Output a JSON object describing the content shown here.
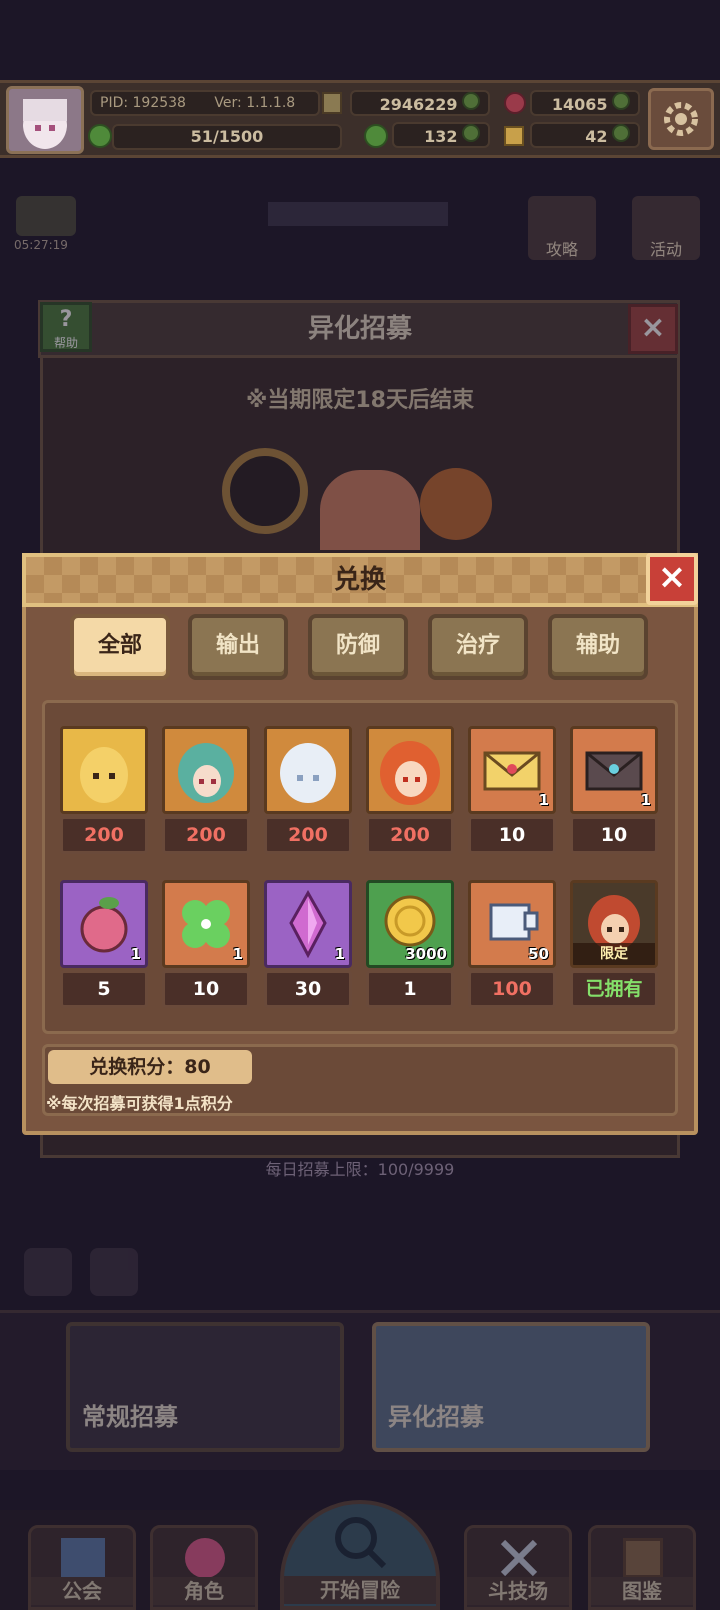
{
  "topbar": {
    "pid": "PID: 192538",
    "version": "Ver: 1.1.1.8",
    "gold": "2946229",
    "gems": "14065",
    "stamina": "51/1500",
    "clover": "132",
    "keys": "42"
  },
  "background": {
    "recruit_title": "异化招募",
    "help_label": "帮助",
    "notice": "※当期限定18天后结束",
    "timer": "05:27:19",
    "side_buttons": [
      "攻略",
      "活动"
    ],
    "daily_limit": "每日招募上限：100/9999"
  },
  "modal": {
    "title": "兑换",
    "close_icon": "close-icon",
    "tabs": [
      {
        "label": "全部",
        "active": true
      },
      {
        "label": "输出",
        "active": false
      },
      {
        "label": "防御",
        "active": false
      },
      {
        "label": "治疗",
        "active": false
      },
      {
        "label": "辅助",
        "active": false
      }
    ],
    "items_row1": [
      {
        "icon": "blonde-girl-portrait",
        "qty": "",
        "price": "200",
        "price_color": "#f07063"
      },
      {
        "icon": "teal-hair-girl-portrait",
        "qty": "",
        "price": "200",
        "price_color": "#f07063"
      },
      {
        "icon": "white-hair-girl-portrait",
        "qty": "",
        "price": "200",
        "price_color": "#f07063"
      },
      {
        "icon": "fire-hair-girl-portrait",
        "qty": "",
        "price": "200",
        "price_color": "#f07063"
      },
      {
        "icon": "yellow-letter-icon",
        "qty": "1",
        "price": "10",
        "price_color": "#ffffff"
      },
      {
        "icon": "dark-letter-icon",
        "qty": "1",
        "price": "10",
        "price_color": "#ffffff"
      }
    ],
    "items_row2": [
      {
        "icon": "pink-fruit-icon",
        "qty": "1",
        "price": "5",
        "price_color": "#ffffff"
      },
      {
        "icon": "clover-icon",
        "qty": "1",
        "price": "10",
        "price_color": "#ffffff"
      },
      {
        "icon": "purple-crystal-icon",
        "qty": "1",
        "price": "30",
        "price_color": "#ffffff"
      },
      {
        "icon": "gold-coin-icon",
        "qty": "3000",
        "price": "1",
        "price_color": "#ffffff"
      },
      {
        "icon": "ticket-icon",
        "qty": "50",
        "price": "100",
        "price_color": "#f07063"
      },
      {
        "icon": "limited-girl-portrait",
        "qty": "",
        "tag": "限定",
        "price": "已拥有",
        "price_color": "#84e06a"
      }
    ],
    "points_label": "兑换积分：80",
    "points_note": "※每次招募可获得1点积分"
  },
  "bottom": {
    "banners": [
      "常规招募",
      "异化招募"
    ],
    "nav": [
      "公会",
      "角色",
      "开始冒险",
      "斗技场",
      "图鉴"
    ]
  }
}
